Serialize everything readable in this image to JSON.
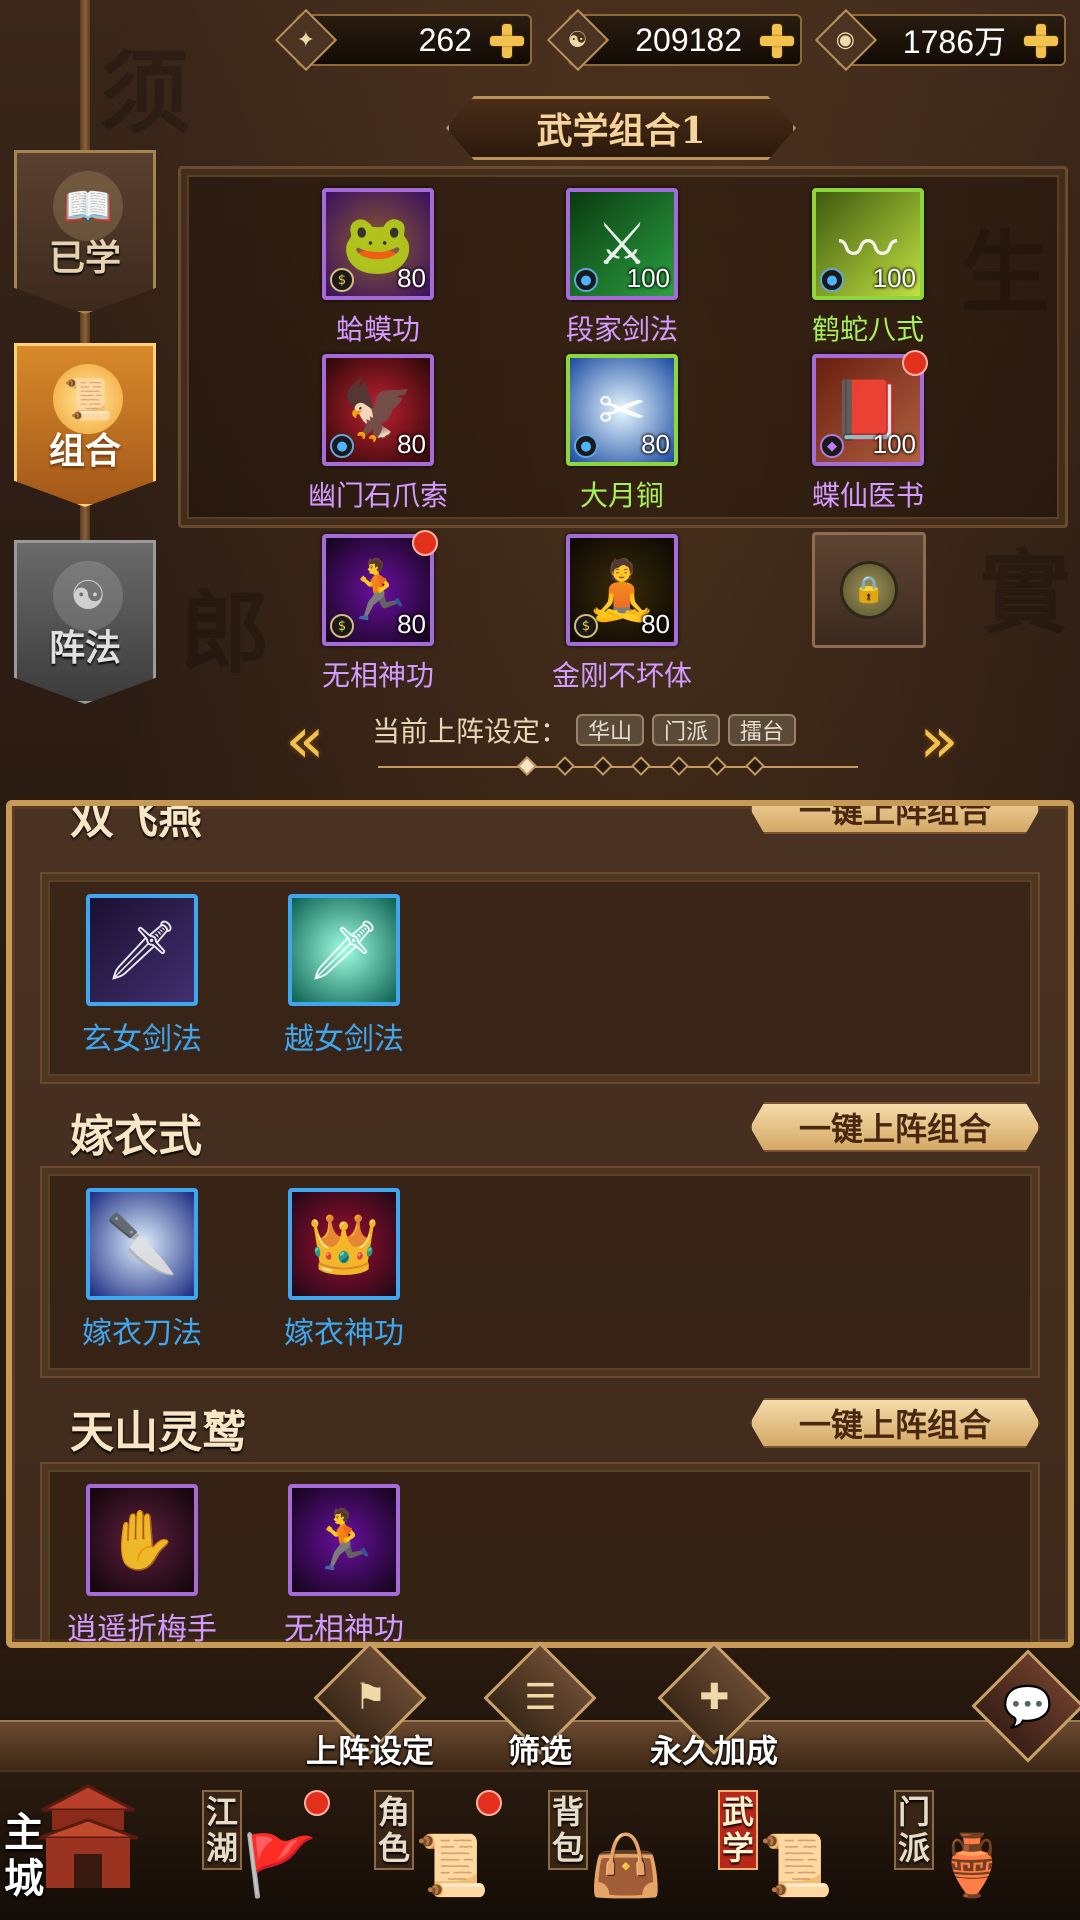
{
  "resources": [
    {
      "icon": "jade-token-icon",
      "value": "262"
    },
    {
      "icon": "taiji-coin-icon",
      "value": "209182"
    },
    {
      "icon": "copper-coin-icon",
      "value": "1786万"
    }
  ],
  "side_tabs": [
    {
      "key": "learned",
      "label": "已学",
      "active": false
    },
    {
      "key": "combo",
      "label": "组合",
      "active": true
    },
    {
      "key": "formation",
      "label": "阵法",
      "active": false
    }
  ],
  "combo": {
    "title": "武学组合1",
    "slots": [
      {
        "name": "蛤蟆功",
        "level": "80",
        "quality": "purple",
        "badge": "gold-coin",
        "notify": false
      },
      {
        "name": "段家剑法",
        "level": "100",
        "quality": "purple",
        "badge": "blue-drop",
        "notify": false
      },
      {
        "name": "鹤蛇八式",
        "level": "100",
        "quality": "green",
        "badge": "blue-drop",
        "notify": false
      },
      {
        "name": "幽门石爪索",
        "level": "80",
        "quality": "purple",
        "badge": "blue-drop",
        "notify": false
      },
      {
        "name": "大月锏",
        "level": "80",
        "quality": "green",
        "badge": "blue-drop",
        "notify": false
      },
      {
        "name": "蝶仙医书",
        "level": "100",
        "quality": "purple",
        "badge": "purple-gem",
        "notify": true
      },
      {
        "name": "无相神功",
        "level": "80",
        "quality": "purple",
        "badge": "gold-coin",
        "notify": true
      },
      {
        "name": "金刚不坏体",
        "level": "80",
        "quality": "purple",
        "badge": "gold-coin",
        "notify": false
      }
    ],
    "locked_slot_icon": "lock-icon"
  },
  "formation": {
    "label": "当前上阵设定：",
    "tags": [
      "华山",
      "门派",
      "擂台"
    ],
    "page_count": 7,
    "active_page": 1
  },
  "groups": [
    {
      "title": "双飞燕",
      "button": "一键上阵组合",
      "skills": [
        {
          "name": "玄女剑法",
          "quality": "blue"
        },
        {
          "name": "越女剑法",
          "quality": "blue"
        }
      ]
    },
    {
      "title": "嫁衣式",
      "button": "一键上阵组合",
      "skills": [
        {
          "name": "嫁衣刀法",
          "quality": "blue"
        },
        {
          "name": "嫁衣神功",
          "quality": "blue"
        }
      ]
    },
    {
      "title": "天山灵鹫",
      "button": "一键上阵组合",
      "skills": [
        {
          "name": "逍遥折梅手",
          "quality": "purple"
        },
        {
          "name": "无相神功",
          "quality": "purple"
        }
      ]
    }
  ],
  "toolbar": {
    "formation_setting": "上阵设定",
    "filter": "筛选",
    "permanent_bonus": "永久加成",
    "chat_icon": "chat-bubble-icon"
  },
  "nav": [
    {
      "label": "主城",
      "icon": "palace-icon",
      "notify": false,
      "active": false
    },
    {
      "label": "江湖",
      "icon": "flag-icon",
      "notify": true,
      "active": false
    },
    {
      "label": "角色",
      "icon": "scroll-icon",
      "notify": true,
      "active": false
    },
    {
      "label": "背包",
      "icon": "bag-icon",
      "notify": false,
      "active": false
    },
    {
      "label": "武学",
      "icon": "manual-icon",
      "notify": false,
      "active": true
    },
    {
      "label": "门派",
      "icon": "cauldron-icon",
      "notify": false,
      "active": false
    }
  ]
}
